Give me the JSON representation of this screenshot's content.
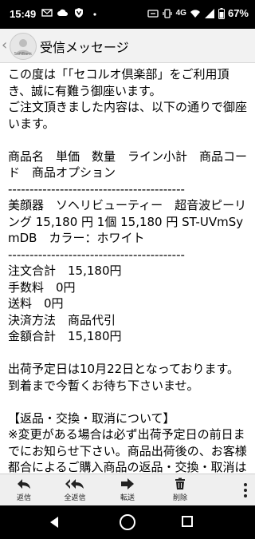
{
  "status_bar": {
    "time": "15:49",
    "network": "4G",
    "battery": "67%",
    "icons_left": [
      "mail-icon",
      "cloud-icon",
      "shield-icon",
      "dot-icon"
    ],
    "icons_right": [
      "signal-icon",
      "vibrate-icon",
      "wifi-icon",
      "signal-bars-icon",
      "battery-icon"
    ]
  },
  "app_bar": {
    "title": "受信メッセージ",
    "avatar_brand": "SoftBank"
  },
  "message": {
    "lines": [
      "この度は「「セコルオ倶楽部」をご利用頂き、誠に有難う御座います。",
      "ご注文頂きました内容は、以下の通りで御座います。",
      "",
      "商品名　単価　数量　ライン小計　商品コード　商品オプション",
      "-----------------------------------------",
      "美顔器　ソヘリビューティー　超音波ピーリング 15,180 円 1個 15,180 円 ST-UVmSymDB　カラー：ホワイト",
      "-----------------------------------------",
      "注文合計　15,180円",
      "手数料　0円",
      "送料　0円",
      "決済方法　商品代引",
      "金額合計　15,180円",
      "",
      "出荷予定日は10月22日となっております。",
      "到着まで今暫くお待ち下さいませ。",
      "",
      "【返品・交換・取消について】",
      "※変更がある場合は必ず出荷予定日の前日までにお知らせ下さい。商品出荷後の、お客様都合によるご購入商品の返品・交換・取消はお受け出来ません。"
    ]
  },
  "toolbar": {
    "reply_label": "返信",
    "reply_all_label": "全返信",
    "forward_label": "転送",
    "delete_label": "削除"
  }
}
